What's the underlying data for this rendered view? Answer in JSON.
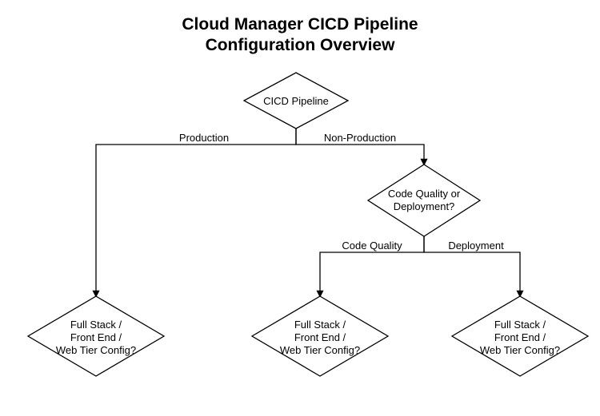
{
  "title": {
    "line1": "Cloud Manager CICD Pipeline",
    "line2": "Configuration Overview"
  },
  "nodes": {
    "root": {
      "label": "CICD Pipeline"
    },
    "codeOrDeploy": {
      "line1": "Code Quality or",
      "line2": "Deployment?"
    },
    "leafA": {
      "line1": "Full Stack /",
      "line2": "Front End /",
      "line3": "Web Tier Config?"
    },
    "leafB": {
      "line1": "Full Stack /",
      "line2": "Front End /",
      "line3": "Web Tier Config?"
    },
    "leafC": {
      "line1": "Full Stack /",
      "line2": "Front End /",
      "line3": "Web Tier Config?"
    }
  },
  "edges": {
    "production": "Production",
    "nonProduction": "Non-Production",
    "codeQuality": "Code Quality",
    "deployment": "Deployment"
  }
}
